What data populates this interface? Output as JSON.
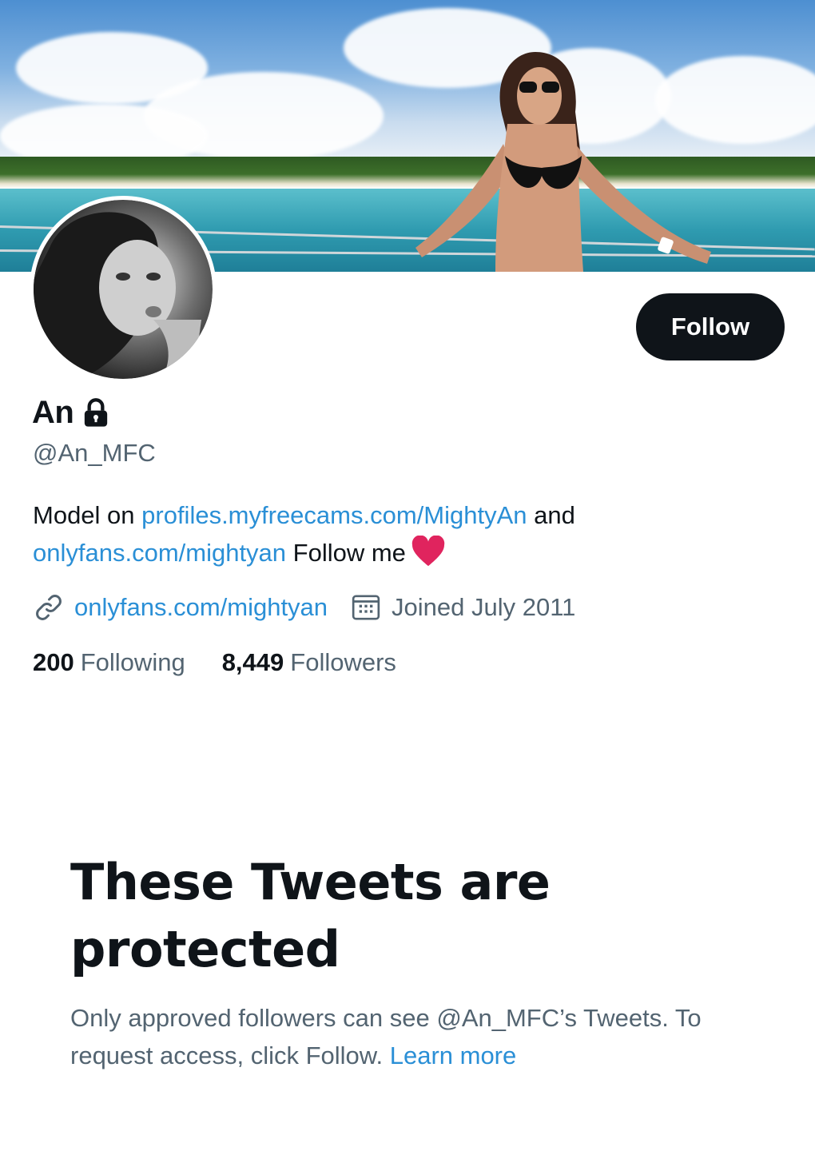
{
  "profile": {
    "display_name": "An",
    "handle": "@An_MFC",
    "follow_label": "Follow"
  },
  "bio": {
    "part1": "Model on ",
    "link1": "profiles.myfreecams.com/MightyAn",
    "part2": " and ",
    "link2": "onlyfans.com/mightyan",
    "part3": " Follow me"
  },
  "meta": {
    "website": "onlyfans.com/mightyan",
    "joined": "Joined July 2011"
  },
  "stats": {
    "following_count": "200",
    "following_label": "Following",
    "followers_count": "8,449",
    "followers_label": "Followers"
  },
  "protected": {
    "title": "These Tweets are protected",
    "body": "Only approved followers can see @An_MFC’s Tweets. To request access, click Follow.",
    "learn_more": "Learn more"
  },
  "colors": {
    "accent": "#2a8fd6",
    "text": "#0f1419",
    "secondary": "#536471",
    "heart": "#e0245e"
  },
  "icons": [
    "lock-icon",
    "link-icon",
    "calendar-icon",
    "heart-icon"
  ]
}
